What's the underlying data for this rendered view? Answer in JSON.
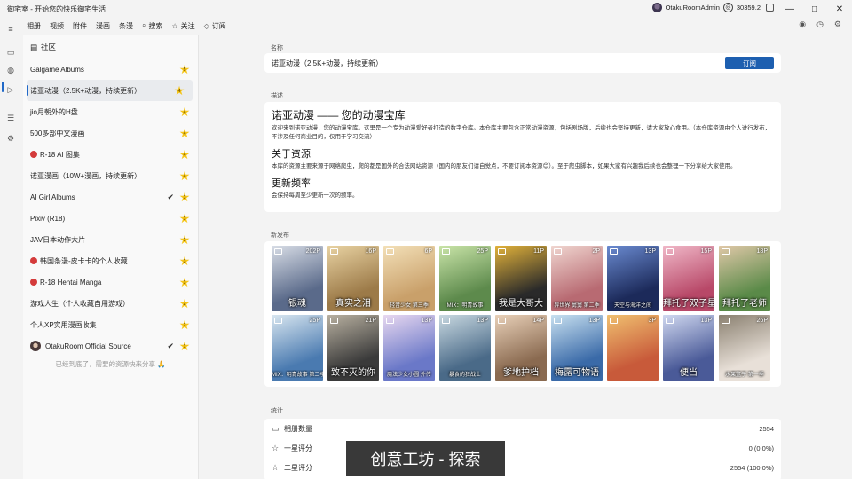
{
  "app": {
    "title": "御宅室 - 开始您的快乐御宅生活",
    "user": "OtakuRoomAdmin",
    "coins": "30359.2"
  },
  "window_controls": [
    "—",
    "□",
    "✕"
  ],
  "menu": [
    {
      "label": "相册",
      "icon": ""
    },
    {
      "label": "视频",
      "icon": ""
    },
    {
      "label": "附件",
      "icon": ""
    },
    {
      "label": "漫画",
      "icon": ""
    },
    {
      "label": "条漫",
      "icon": ""
    },
    {
      "label": "搜索",
      "icon": "search-icon"
    },
    {
      "label": "关注",
      "icon": "star-icon"
    },
    {
      "label": "订阅",
      "icon": "tag-icon"
    }
  ],
  "sidebar": {
    "header": "社区",
    "items": [
      {
        "label": "Galgame Albums",
        "level": "5",
        "r18": false,
        "checked": false,
        "avatar": false
      },
      {
        "label": "诺亚动漫（2.5K+动漫，持续更新）",
        "level": "4",
        "r18": false,
        "checked": false,
        "avatar": false,
        "selected": true
      },
      {
        "label": "jio月朝外的H盘",
        "level": "4",
        "r18": false,
        "checked": false,
        "avatar": false
      },
      {
        "label": "500多部中文漫画",
        "level": "4",
        "r18": false,
        "checked": false,
        "avatar": false
      },
      {
        "label": "R-18 AI 图集",
        "level": "4",
        "r18": true,
        "checked": false,
        "avatar": false
      },
      {
        "label": "诺亚漫画（10W+漫画，持续更新）",
        "level": "4",
        "r18": false,
        "checked": false,
        "avatar": false
      },
      {
        "label": "AI Girl Albums",
        "level": "3",
        "r18": false,
        "checked": true,
        "avatar": false
      },
      {
        "label": "Pixiv (R18)",
        "level": "3",
        "r18": false,
        "checked": false,
        "avatar": false
      },
      {
        "label": "JAV日本动作大片",
        "level": "3",
        "r18": false,
        "checked": false,
        "avatar": false
      },
      {
        "label": "韩国条漫-皮卡卡的个人收藏",
        "level": "3",
        "r18": true,
        "checked": false,
        "avatar": false
      },
      {
        "label": "R-18 Hentai Manga",
        "level": "3",
        "r18": true,
        "checked": false,
        "avatar": false
      },
      {
        "label": "游戏人生（个人收藏自用游戏）",
        "level": "2",
        "r18": false,
        "checked": false,
        "avatar": false
      },
      {
        "label": "个人XP实用漫画收集",
        "level": "2",
        "r18": false,
        "checked": false,
        "avatar": false
      },
      {
        "label": "OtakuRoom Official Source",
        "level": "1",
        "r18": false,
        "checked": true,
        "avatar": true
      }
    ],
    "footer": "已经到底了，需要的资源快来分享 🙏"
  },
  "main": {
    "name_label": "名称",
    "name_value": "诺亚动漫（2.5K+动漫，持续更新）",
    "subscribe_label": "订阅",
    "desc_label": "描述",
    "desc_title": "诺亚动漫 —— 您的动漫宝库",
    "desc_intro": "欢迎来到诺亚动漫，您的动漫宝库。这里是一个专为动漫爱好者打造的数字仓库。本仓库主要包含正常动漫资源，包括剧场版，后续也会坚持更新，请大家放心食用。（本仓库资源由个人进行发布，不涉及任何商业目的，仅用于学习交流）",
    "desc_h2_source": "关于资源",
    "desc_source": "本库的资源主要来源于网络爬虫，爬的都是国外的合法网站资源（国内的朋友们请自觉点，不要订阅本资源😊）。至于爬虫脚本，如果大家有兴趣我后续也会整理一下分享给大家使用。",
    "desc_h2_freq": "更新频率",
    "desc_freq": "会保持每周至少更新一次的频率。",
    "new_label": "新发布",
    "thumbs": [
      {
        "caption": "银魂",
        "pages": "202P",
        "small": false,
        "c1": "#5a6a8a",
        "c2": "#d8dde6"
      },
      {
        "caption": "真实之泪",
        "pages": "16P",
        "small": false,
        "c1": "#9c7a48",
        "c2": "#e8d2a2"
      },
      {
        "caption": "轻音少女 第三季",
        "pages": "6P",
        "small": true,
        "c1": "#c9a06a",
        "c2": "#f3e0b8"
      },
      {
        "caption": "MIX：明青故事",
        "pages": "25P",
        "small": true,
        "c1": "#5d8a4c",
        "c2": "#c9e4a8"
      },
      {
        "caption": "我是大哥大",
        "pages": "11P",
        "small": false,
        "c1": "#2a2a2a",
        "c2": "#e2b23a"
      },
      {
        "caption": "异世界 舅舅 第二季",
        "pages": "2P",
        "small": true,
        "c1": "#b86a72",
        "c2": "#f0d6d0"
      },
      {
        "caption": "天空与海洋之间",
        "pages": "13P",
        "small": true,
        "c1": "#1c2a5a",
        "c2": "#6a8ad0"
      },
      {
        "caption": "拜托了双子星",
        "pages": "15P",
        "small": false,
        "c1": "#b84868",
        "c2": "#f0b8c8"
      },
      {
        "caption": "拜托了老师",
        "pages": "18P",
        "small": false,
        "c1": "#5a8a48",
        "c2": "#e0c8a8"
      },
      {
        "caption": "MIX：明青故事 第二季",
        "pages": "25P",
        "small": true,
        "c1": "#4a7ab0",
        "c2": "#d8e6f0"
      },
      {
        "caption": "致不灭的你",
        "pages": "21P",
        "small": false,
        "c1": "#3a3a3a",
        "c2": "#b8b0a0"
      },
      {
        "caption": "魔法少女小圆 外传",
        "pages": "13P",
        "small": true,
        "c1": "#6a78c8",
        "c2": "#e8d8f0"
      },
      {
        "caption": "暴食的狂战士",
        "pages": "13P",
        "small": true,
        "c1": "#4a6a88",
        "c2": "#c8d8e0"
      },
      {
        "caption": "爹地护档",
        "pages": "14P",
        "small": false,
        "c1": "#8a6a50",
        "c2": "#e8d0b8"
      },
      {
        "caption": "梅露可物语",
        "pages": "13P",
        "small": false,
        "c1": "#3a6aa8",
        "c2": "#c8e0f0"
      },
      {
        "caption": "",
        "pages": "3P",
        "small": false,
        "c1": "#c85a3a",
        "c2": "#f0c070"
      },
      {
        "caption": "便当",
        "pages": "13P",
        "small": false,
        "c1": "#4a5a98",
        "c2": "#d0d8f0"
      },
      {
        "caption": "水果篮子 第一季",
        "pages": "26P",
        "small": true,
        "c1": "#e8e0d8",
        "c2": "#8a8070"
      }
    ],
    "stats_label": "统计",
    "stats": [
      {
        "icon": "album-icon",
        "label": "相册数量",
        "value": "2554"
      },
      {
        "icon": "star-1-icon",
        "label": "一星评分",
        "value": "0 (0.0%)"
      },
      {
        "icon": "star-2-icon",
        "label": "二星评分",
        "value": "2554 (100.0%)"
      }
    ]
  },
  "toast": "创意工坊 - 探索",
  "colors": {
    "accent": "#2169c8",
    "button": "#1d5fb0",
    "star": "#f5c518",
    "r18": "#d43b3b"
  }
}
